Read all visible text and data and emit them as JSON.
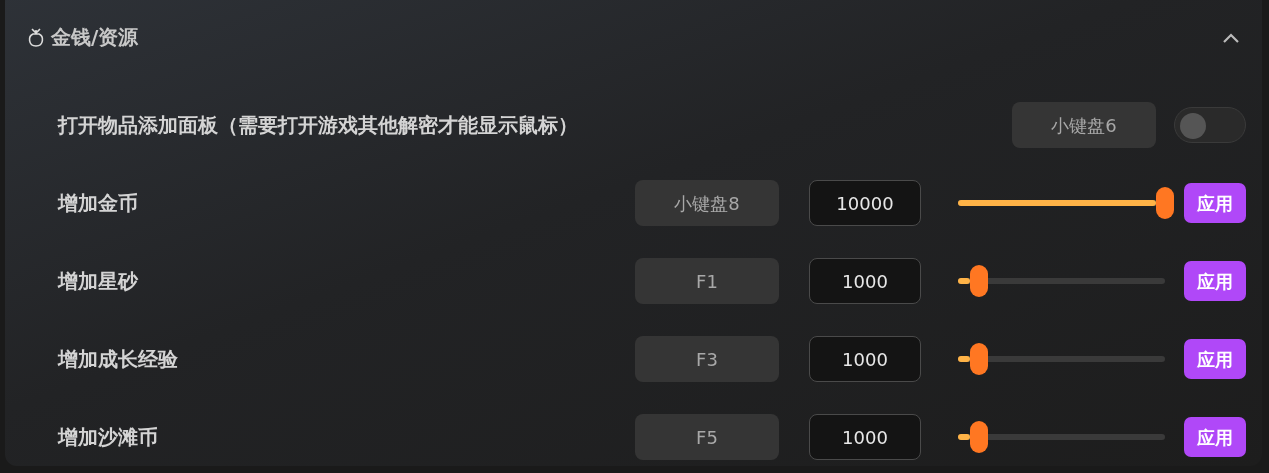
{
  "section": {
    "title": "金钱/资源",
    "expanded": true
  },
  "rows": [
    {
      "kind": "toggle",
      "label": "打开物品添加面板（需要打开游戏其他解密才能显示鼠标）",
      "hotkey": "小键盘6",
      "on": false
    },
    {
      "kind": "slider",
      "label": "增加金币",
      "hotkey": "小键盘8",
      "value": "10000",
      "level": 1,
      "button": "应用"
    },
    {
      "kind": "slider",
      "label": "增加星砂",
      "hotkey": "F1",
      "value": "1000",
      "level": 0.1,
      "button": "应用"
    },
    {
      "kind": "slider",
      "label": "增加成长经验",
      "hotkey": "F3",
      "value": "1000",
      "level": 0.1,
      "button": "应用"
    },
    {
      "kind": "slider",
      "label": "增加沙滩币",
      "hotkey": "F5",
      "value": "1000",
      "level": 0.1,
      "button": "应用"
    }
  ]
}
